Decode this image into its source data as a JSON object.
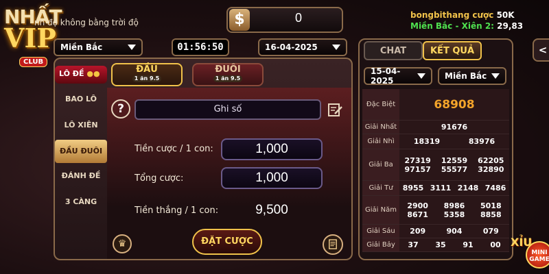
{
  "ticker": "nh độ không bằng trời độ",
  "balance": "0",
  "top_right": {
    "user": "bongbithang",
    "bet_label": "cược",
    "bet_value": "50K",
    "region_label": "Miền Bắc - Xiên 2:",
    "region_value": "29,83"
  },
  "logo": {
    "line1": "NHẤT",
    "line2": "VIP",
    "club": "CLUB"
  },
  "left_region": "Miền Bắc",
  "timer": "01:56:50",
  "date": "16-04-2025",
  "lode": {
    "label": "LÔ ĐỀ",
    "dots": "●●"
  },
  "sidebar": [
    {
      "label": "BAO LÔ"
    },
    {
      "label": "LÔ XIÊN"
    },
    {
      "label": "ĐẦU ĐUÔI"
    },
    {
      "label": "ĐÁNH ĐỀ"
    },
    {
      "label": "3 CÀNG"
    }
  ],
  "tabs": [
    {
      "label": "ĐẦU",
      "sub": "1 ăn 9.5"
    },
    {
      "label": "ĐUÔI",
      "sub": "1 ăn 9.5"
    }
  ],
  "input_placeholder": "Ghi số",
  "bet_per_label": "Tiền cược / 1 con:",
  "bet_per_value": "1,000",
  "total_label": "Tổng cược:",
  "total_value": "1,000",
  "win_label": "Tiền thắng / 1 con:",
  "win_value": "9,500",
  "place_bet": "ĐẶT CƯỢC",
  "results": {
    "tab_chat": "CHAT",
    "tab_results": "KẾT QUẢ",
    "date": "15-04-2025",
    "region": "Miền Bắc",
    "rows": [
      {
        "label": "Đặc Biệt",
        "values": [
          "68908"
        ]
      },
      {
        "label": "Giải Nhất",
        "values": [
          "91676"
        ]
      },
      {
        "label": "Giải Nhì",
        "values": [
          "18319",
          "83976"
        ]
      },
      {
        "label": "Giải Ba",
        "values": [
          "27319",
          "12559",
          "62205",
          "97157",
          "55577",
          "32890"
        ]
      },
      {
        "label": "Giải Tư",
        "values": [
          "8955",
          "3111",
          "2148",
          "7486"
        ]
      },
      {
        "label": "Giải Năm",
        "values": [
          "2900",
          "8986",
          "5018",
          "8671",
          "5358",
          "8858"
        ]
      },
      {
        "label": "Giải Sáu",
        "values": [
          "209",
          "904",
          "079"
        ]
      },
      {
        "label": "Giải Bảy",
        "values": [
          "37",
          "35",
          "91",
          "00"
        ]
      }
    ]
  },
  "xiu": "XỈU",
  "mini": "MINI GAME"
}
